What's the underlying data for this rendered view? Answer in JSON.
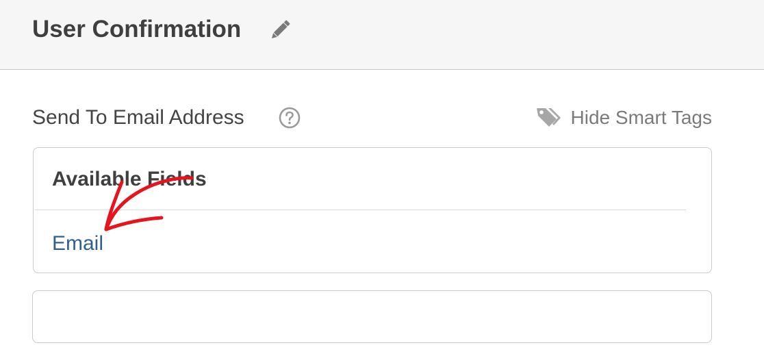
{
  "header": {
    "title": "User Confirmation",
    "edit_icon": "pencil-icon"
  },
  "field": {
    "label": "Send To Email Address",
    "help_icon": "question-circle-icon",
    "smart_tags_toggle": "Hide Smart Tags",
    "smart_tags_icon": "tag-icon"
  },
  "available_fields": {
    "heading": "Available Fields",
    "items": [
      {
        "label": "Email"
      }
    ]
  },
  "input": {
    "value": "",
    "placeholder": ""
  },
  "annotation": {
    "arrow_color": "#e8141d"
  },
  "colors": {
    "header_bg": "#f6f6f6",
    "link": "#2f5f8f",
    "text": "#444444",
    "muted": "#7a7a7a",
    "border": "#c9c9c9"
  }
}
